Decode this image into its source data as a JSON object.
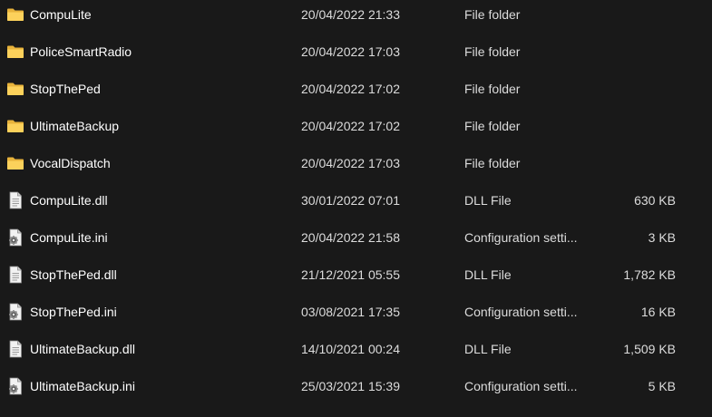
{
  "files": [
    {
      "name": "CompuLite",
      "date": "20/04/2022 21:33",
      "type": "File folder",
      "size": "",
      "icon": "folder-icon"
    },
    {
      "name": "PoliceSmartRadio",
      "date": "20/04/2022 17:03",
      "type": "File folder",
      "size": "",
      "icon": "folder-icon"
    },
    {
      "name": "StopThePed",
      "date": "20/04/2022 17:02",
      "type": "File folder",
      "size": "",
      "icon": "folder-icon"
    },
    {
      "name": "UltimateBackup",
      "date": "20/04/2022 17:02",
      "type": "File folder",
      "size": "",
      "icon": "folder-icon"
    },
    {
      "name": "VocalDispatch",
      "date": "20/04/2022 17:03",
      "type": "File folder",
      "size": "",
      "icon": "folder-icon"
    },
    {
      "name": "CompuLite.dll",
      "date": "30/01/2022 07:01",
      "type": "DLL File",
      "size": "630 KB",
      "icon": "dll-file-icon"
    },
    {
      "name": "CompuLite.ini",
      "date": "20/04/2022 21:58",
      "type": "Configuration setti...",
      "size": "3 KB",
      "icon": "config-file-icon"
    },
    {
      "name": "StopThePed.dll",
      "date": "21/12/2021 05:55",
      "type": "DLL File",
      "size": "1,782 KB",
      "icon": "dll-file-icon"
    },
    {
      "name": "StopThePed.ini",
      "date": "03/08/2021 17:35",
      "type": "Configuration setti...",
      "size": "16 KB",
      "icon": "config-file-icon"
    },
    {
      "name": "UltimateBackup.dll",
      "date": "14/10/2021 00:24",
      "type": "DLL File",
      "size": "1,509 KB",
      "icon": "dll-file-icon"
    },
    {
      "name": "UltimateBackup.ini",
      "date": "25/03/2021 15:39",
      "type": "Configuration setti...",
      "size": "5 KB",
      "icon": "config-file-icon"
    }
  ]
}
